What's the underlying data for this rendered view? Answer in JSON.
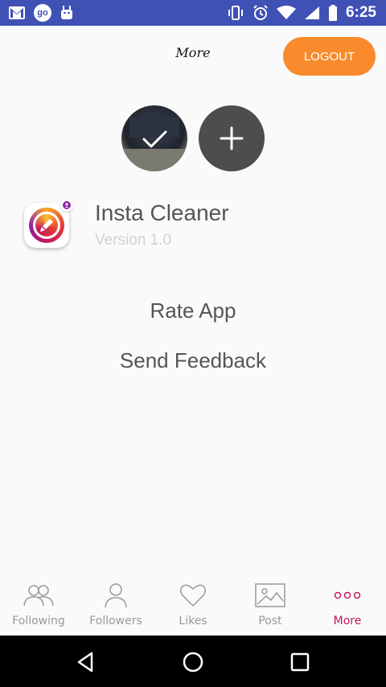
{
  "status_bar": {
    "go_badge": "go",
    "time": "6:25"
  },
  "header": {
    "title": "More",
    "logout_label": "LOGOUT"
  },
  "app_info": {
    "name": "Insta Cleaner",
    "version": "Version 1.0"
  },
  "actions": {
    "rate": "Rate App",
    "feedback": "Send Feedback"
  },
  "bottom_nav": {
    "items": [
      {
        "label": "Following",
        "icon": "following-icon"
      },
      {
        "label": "Followers",
        "icon": "followers-icon"
      },
      {
        "label": "Likes",
        "icon": "likes-icon"
      },
      {
        "label": "Post",
        "icon": "post-icon"
      },
      {
        "label": "More",
        "icon": "more-icon"
      }
    ],
    "active_index": 4
  },
  "colors": {
    "status_bar": "#3f51b5",
    "accent_orange": "#f98b2c",
    "active_nav": "#c2185b",
    "inactive_nav": "#999999"
  }
}
